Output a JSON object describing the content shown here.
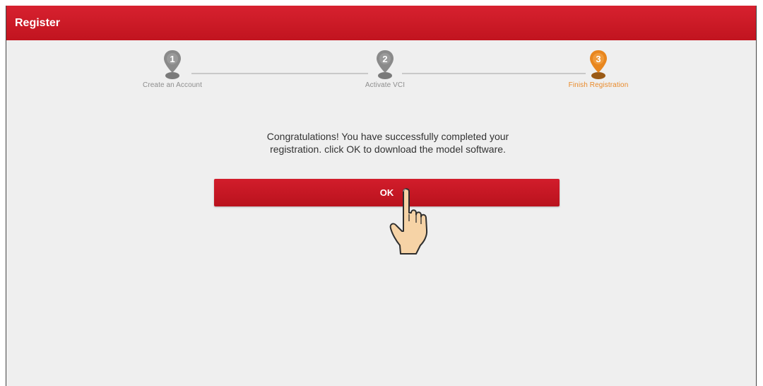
{
  "window": {
    "title": "Register"
  },
  "steps": [
    {
      "number": "1",
      "label": "Create an Account",
      "state": "done"
    },
    {
      "number": "2",
      "label": "Activate VCI",
      "state": "done"
    },
    {
      "number": "3",
      "label": "Finish Registration",
      "state": "active"
    }
  ],
  "message": {
    "line1": "Congratulations! You have successfully completed your",
    "line2": "registration. click OK to download the model software."
  },
  "ok_button": {
    "label": "OK"
  },
  "colors": {
    "header_red": "#c1141f",
    "button_red": "#c3171f",
    "step_done": "#8a8a8a",
    "step_active": "#e98a2a"
  },
  "icons": {
    "pointer": "hand-pointer-icon",
    "step_marker": "map-pin-icon"
  }
}
